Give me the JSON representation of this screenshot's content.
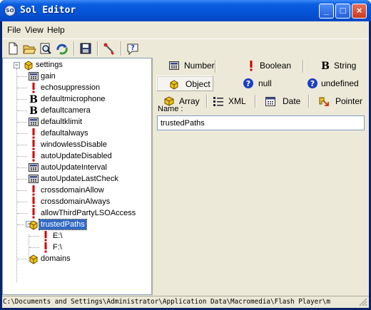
{
  "window": {
    "title": "Sol Editor",
    "icon_text": "SO",
    "minimize": "_",
    "maximize": "□",
    "close": "×"
  },
  "menu": [
    {
      "label": "File"
    },
    {
      "label": "View"
    },
    {
      "label": "Help"
    }
  ],
  "toolbar": [
    "new-file-icon",
    "open-folder-icon",
    "find-icon",
    "refresh-icon",
    "save-icon",
    "settings-tool-icon",
    "help-icon"
  ],
  "tree": {
    "root": "settings",
    "children": [
      {
        "label": "gain",
        "type": "number"
      },
      {
        "label": "echosuppression",
        "type": "boolean"
      },
      {
        "label": "defaultmicrophone",
        "type": "string"
      },
      {
        "label": "defaultcamera",
        "type": "string"
      },
      {
        "label": "defaultklimit",
        "type": "number"
      },
      {
        "label": "defaultalways",
        "type": "boolean"
      },
      {
        "label": "windowlessDisable",
        "type": "boolean"
      },
      {
        "label": "autoUpdateDisabled",
        "type": "boolean"
      },
      {
        "label": "autoUpdateInterval",
        "type": "number"
      },
      {
        "label": "autoUpdateLastCheck",
        "type": "number"
      },
      {
        "label": "crossdomainAllow",
        "type": "boolean"
      },
      {
        "label": "crossdomainAlways",
        "type": "boolean"
      },
      {
        "label": "allowThirdPartyLSOAccess",
        "type": "boolean"
      },
      {
        "label": "trustedPaths",
        "type": "object",
        "selected": true,
        "children": [
          {
            "label": "E:\\",
            "type": "boolean"
          },
          {
            "label": "F:\\",
            "type": "boolean"
          }
        ]
      },
      {
        "label": "domains",
        "type": "object"
      }
    ]
  },
  "type_buttons": [
    {
      "label": "Number",
      "icon": "number-icon",
      "pressed": false
    },
    {
      "label": "Boolean",
      "icon": "boolean-icon",
      "pressed": false
    },
    {
      "label": "String",
      "icon": "string-icon",
      "pressed": false
    },
    {
      "label": "Object",
      "icon": "object-icon",
      "pressed": true
    },
    {
      "label": "null",
      "icon": "null-icon",
      "pressed": false
    },
    {
      "label": "undefined",
      "icon": "undefined-icon",
      "pressed": false
    },
    {
      "label": "Array",
      "icon": "array-icon",
      "pressed": false
    },
    {
      "label": "XML",
      "icon": "xml-icon",
      "pressed": false
    },
    {
      "label": "Date",
      "icon": "date-icon",
      "pressed": false
    },
    {
      "label": "Pointer",
      "icon": "pointer-icon",
      "pressed": false
    }
  ],
  "name_field": {
    "label": "Name :",
    "value": "trustedPaths"
  },
  "status": {
    "path": "C:\\Documents and Settings\\Administrator\\Application Data\\Macromedia\\Flash Player\\m"
  },
  "colors": {
    "title_bar": "#0553d6",
    "selection": "#316ac5",
    "face": "#ece9d8",
    "boolean_mark": "#cc0000",
    "null_mark": "#1a3fc4"
  }
}
